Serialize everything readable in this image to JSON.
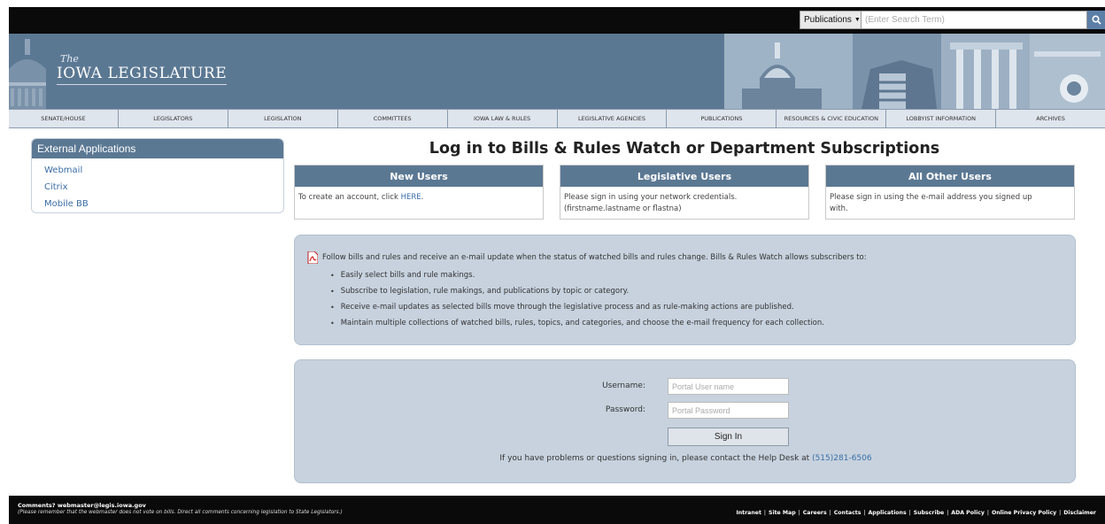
{
  "search": {
    "select_value": "Publications",
    "placeholder": "(Enter Search Term)"
  },
  "header": {
    "logo_the": "The",
    "logo_name": "IOWA LEGISLATURE"
  },
  "nav": [
    {
      "label": "SENATE/HOUSE"
    },
    {
      "label": "LEGISLATORS"
    },
    {
      "label": "LEGISLATION"
    },
    {
      "label": "COMMITTEES"
    },
    {
      "label": "IOWA LAW & RULES"
    },
    {
      "label": "LEGISLATIVE AGENCIES"
    },
    {
      "label": "PUBLICATIONS"
    },
    {
      "label": "RESOURCES & CIVIC EDUCATION"
    },
    {
      "label": "LOBBYIST INFORMATION"
    },
    {
      "label": "ARCHIVES"
    }
  ],
  "sidebar": {
    "title": "External Applications",
    "items": [
      "Webmail",
      "Citrix",
      "Mobile BB"
    ]
  },
  "main": {
    "title": "Log in to Bills & Rules Watch or Department Subscriptions"
  },
  "boxes": {
    "new_users": {
      "title": "New Users",
      "text": "To create an account, click ",
      "link": "HERE",
      "suffix": "."
    },
    "legislative_users": {
      "title": "Legislative Users",
      "line1": "Please sign in using your network credentials.",
      "line2": "(firstname.lastname or flastna)"
    },
    "other_users": {
      "title": "All Other Users",
      "line1": "Please sign in using the e-mail address you signed up",
      "line2": "with."
    }
  },
  "info": {
    "lead": "Follow bills and rules and receive an e-mail update when the status of watched bills and rules change. Bills & Rules Watch allows subscribers to:",
    "items": [
      "Easily select bills and rule makings.",
      "Subscribe to legislation, rule makings, and publications by topic or category.",
      "Receive e-mail updates as selected bills move through the legislative process and as rule-making actions are published.",
      "Maintain multiple collections of watched bills, rules, topics, and categories, and choose the e-mail frequency for each collection."
    ]
  },
  "login": {
    "username_label": "Username:",
    "username_placeholder": "Portal User name",
    "password_label": "Password:",
    "password_placeholder": "Portal Password",
    "signin_label": "Sign In",
    "help_text": "If you have problems or questions signing in, please contact the Help Desk at ",
    "help_phone": "(515)281-6506"
  },
  "footer": {
    "comments": "Comments? webmaster@legis.iowa.gov",
    "note": "(Please remember that the webmaster does not vote on bills. Direct all comments concerning legislation to State Legislators.)",
    "links": [
      "Intranet",
      "Site Map",
      "Careers",
      "Contacts",
      "Applications",
      "Subscribe",
      "ADA Policy",
      "Online Privacy Policy",
      "Disclaimer"
    ]
  },
  "colors": {
    "accent": "#5b7893",
    "link": "#3a6ea5",
    "panel": "#c7d2de"
  }
}
